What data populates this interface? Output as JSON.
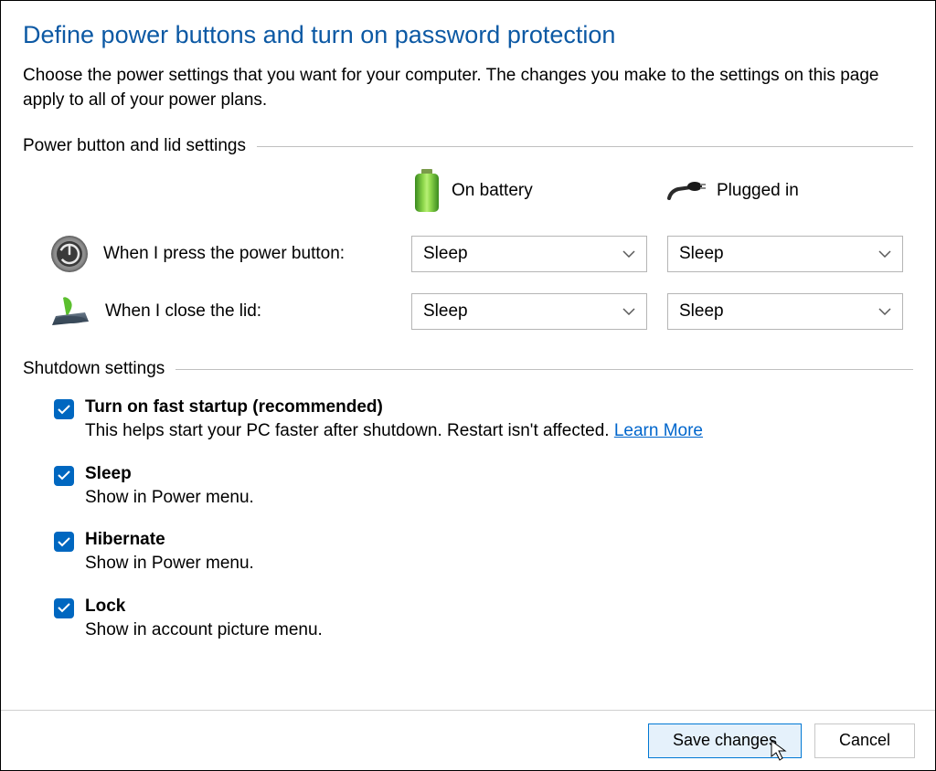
{
  "header": {
    "title": "Define power buttons and turn on password protection",
    "description": "Choose the power settings that you want for your computer. The changes you make to the settings on this page apply to all of your power plans."
  },
  "power_section": {
    "title": "Power button and lid settings",
    "col_battery": "On battery",
    "col_plugged": "Plugged in",
    "power_button_label": "When I press the power button:",
    "power_button_battery": "Sleep",
    "power_button_plugged": "Sleep",
    "lid_label": "When I close the lid:",
    "lid_battery": "Sleep",
    "lid_plugged": "Sleep"
  },
  "shutdown_section": {
    "title": "Shutdown settings",
    "items": [
      {
        "title": "Turn on fast startup (recommended)",
        "desc_prefix": "This helps start your PC faster after shutdown. Restart isn't affected. ",
        "link": "Learn More"
      },
      {
        "title": "Sleep",
        "desc": "Show in Power menu."
      },
      {
        "title": "Hibernate",
        "desc": "Show in Power menu."
      },
      {
        "title": "Lock",
        "desc": "Show in account picture menu."
      }
    ]
  },
  "footer": {
    "save": "Save changes",
    "cancel": "Cancel"
  }
}
